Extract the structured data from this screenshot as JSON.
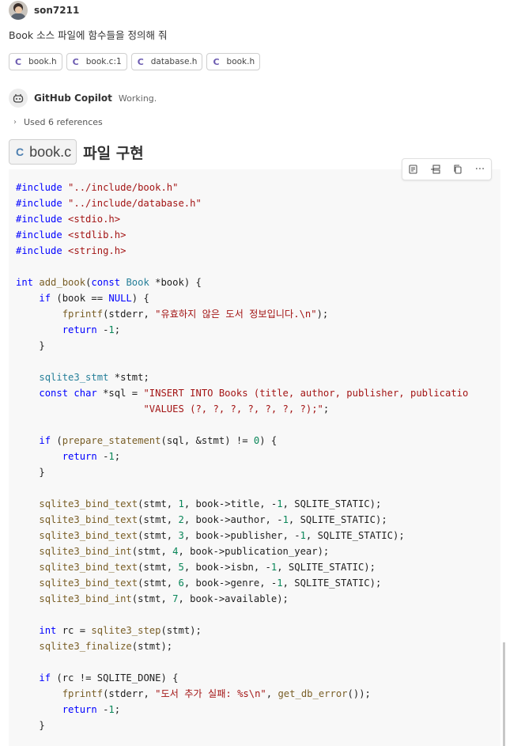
{
  "user": {
    "name": "son7211"
  },
  "prompt": "Book 소스 파일에 함수들을 정의해 줘",
  "references": [
    {
      "icon": "C",
      "label": "book.h"
    },
    {
      "icon": "C",
      "label": "book.c:1"
    },
    {
      "icon": "C",
      "label": "database.h"
    },
    {
      "icon": "C",
      "label": "book.h"
    }
  ],
  "assistant": {
    "name": "GitHub Copilot",
    "status": "Working."
  },
  "used_references": "Used 6 references",
  "heading": {
    "file_icon": "C",
    "file_name": "book.c",
    "title": "파일 구현"
  },
  "toolbar": [
    "apply-in-editor-icon",
    "insert-at-cursor-icon",
    "copy-icon",
    "more-actions-icon"
  ],
  "code_lines": [
    "#include \"../include/book.h\"",
    "#include \"../include/database.h\"",
    "#include <stdio.h>",
    "#include <stdlib.h>",
    "#include <string.h>",
    "",
    "int add_book(const Book *book) {",
    "    if (book == NULL) {",
    "        fprintf(stderr, \"유효하지 않은 도서 정보입니다.\\n\");",
    "        return -1;",
    "    }",
    "",
    "    sqlite3_stmt *stmt;",
    "    const char *sql = \"INSERT INTO Books (title, author, publisher, publicatio",
    "                      \"VALUES (?, ?, ?, ?, ?, ?, ?);\";",
    "",
    "    if (prepare_statement(sql, &stmt) != 0) {",
    "        return -1;",
    "    }",
    "",
    "    sqlite3_bind_text(stmt, 1, book->title, -1, SQLITE_STATIC);",
    "    sqlite3_bind_text(stmt, 2, book->author, -1, SQLITE_STATIC);",
    "    sqlite3_bind_text(stmt, 3, book->publisher, -1, SQLITE_STATIC);",
    "    sqlite3_bind_int(stmt, 4, book->publication_year);",
    "    sqlite3_bind_text(stmt, 5, book->isbn, -1, SQLITE_STATIC);",
    "    sqlite3_bind_text(stmt, 6, book->genre, -1, SQLITE_STATIC);",
    "    sqlite3_bind_int(stmt, 7, book->available);",
    "",
    "    int rc = sqlite3_step(stmt);",
    "    sqlite3_finalize(stmt);",
    "",
    "    if (rc != SQLITE_DONE) {",
    "        fprintf(stderr, \"도서 추가 실패: %s\\n\", get_db_error());",
    "        return -1;",
    "    }"
  ]
}
